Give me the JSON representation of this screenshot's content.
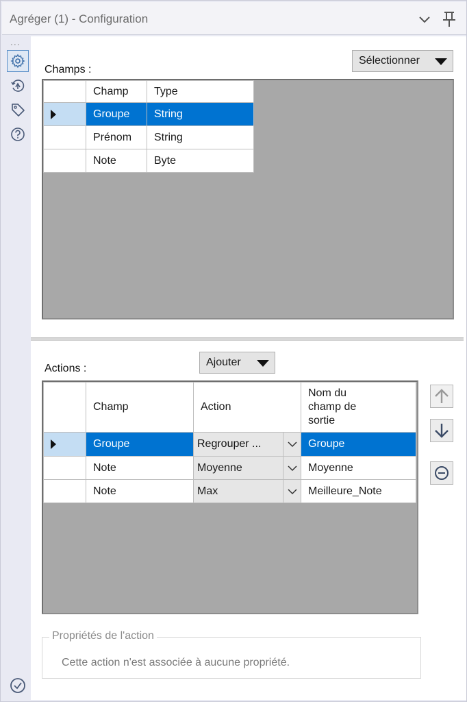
{
  "window": {
    "title": "Agréger (1) - Configuration"
  },
  "rail": {
    "dots": "...",
    "icons": [
      "gear-icon",
      "compass-arrow-icon",
      "tag-icon",
      "help-icon"
    ]
  },
  "fields": {
    "label": "Champs :",
    "select_button": "Sélectionner",
    "columns": [
      "Champ",
      "Type"
    ],
    "rows": [
      {
        "champ": "Groupe",
        "type": "String",
        "selected": true
      },
      {
        "champ": "Prénom",
        "type": "String",
        "selected": false
      },
      {
        "champ": "Note",
        "type": "Byte",
        "selected": false
      }
    ]
  },
  "actions": {
    "label": "Actions :",
    "add_button": "Ajouter",
    "columns": [
      "Champ",
      "Action",
      "Nom du champ de sortie"
    ],
    "header_output_lines": [
      "Nom du",
      "champ de",
      "sortie"
    ],
    "rows": [
      {
        "champ": "Groupe",
        "action": "Regrouper ...",
        "output": "Groupe",
        "selected": true
      },
      {
        "champ": "Note",
        "action": "Moyenne",
        "output": "Moyenne",
        "selected": false
      },
      {
        "champ": "Note",
        "action": "Max",
        "output": "Meilleure_Note",
        "selected": false
      }
    ]
  },
  "properties": {
    "legend": "Propriétés de l'action",
    "text": "Cette action n'est associée à aucune propriété."
  },
  "colors": {
    "selection": "#0073d1",
    "row_header_selected": "#c4ddf3",
    "grid_background": "#a8a8a8"
  }
}
